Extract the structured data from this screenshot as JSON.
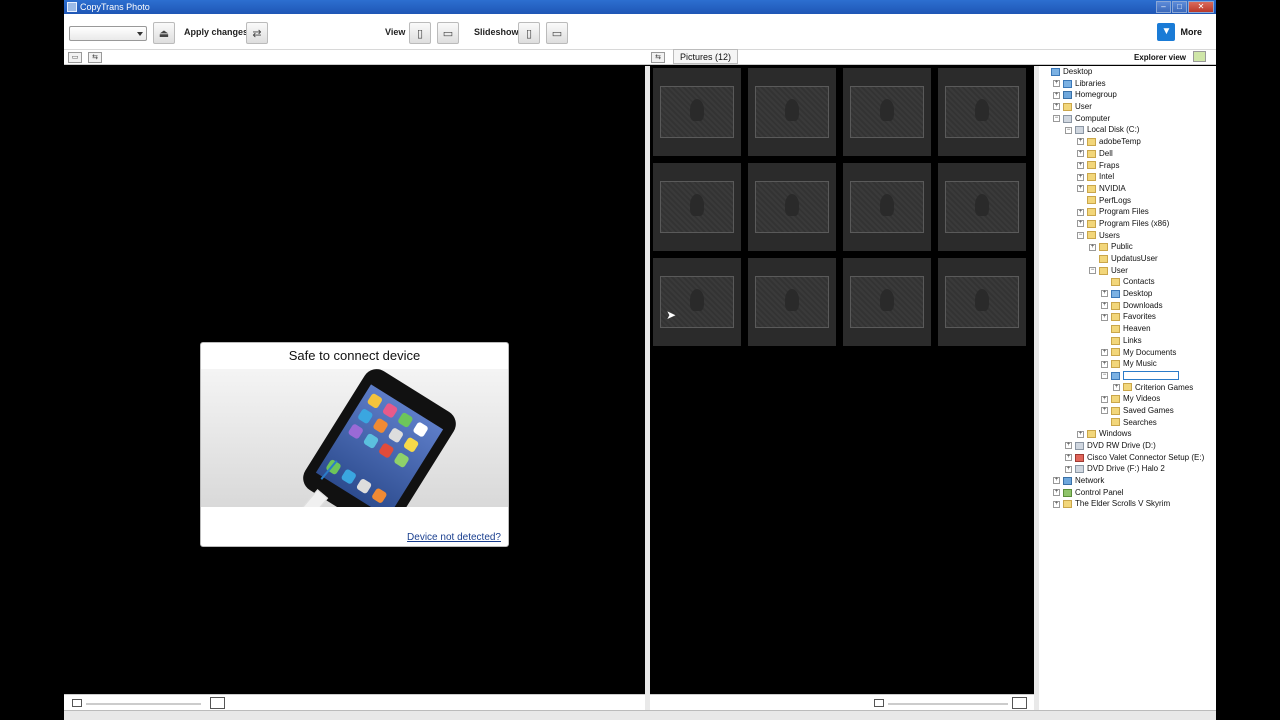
{
  "window": {
    "title": "CopyTrans Photo"
  },
  "toolbar": {
    "apply_label": "Apply changes",
    "view_label": "View",
    "slideshow_label": "Slideshow",
    "more_label": "More"
  },
  "pictures_tab": {
    "label": "Pictures (12)"
  },
  "explorer": {
    "label": "Explorer view"
  },
  "dialog": {
    "title": "Safe to connect device",
    "link": "Device not detected?"
  },
  "thumbnails": {
    "count": 12
  },
  "tree": {
    "items": [
      {
        "label": "Desktop",
        "depth": 0,
        "expander": "",
        "icon": "blue"
      },
      {
        "label": "Libraries",
        "depth": 1,
        "expander": "+",
        "icon": "blue"
      },
      {
        "label": "Homegroup",
        "depth": 1,
        "expander": "+",
        "icon": "net"
      },
      {
        "label": "User",
        "depth": 1,
        "expander": "+",
        "icon": "folder"
      },
      {
        "label": "Computer",
        "depth": 1,
        "expander": "−",
        "icon": "drive"
      },
      {
        "label": "Local Disk (C:)",
        "depth": 2,
        "expander": "−",
        "icon": "drive"
      },
      {
        "label": "adobeTemp",
        "depth": 3,
        "expander": "+",
        "icon": "folder"
      },
      {
        "label": "Dell",
        "depth": 3,
        "expander": "+",
        "icon": "folder"
      },
      {
        "label": "Fraps",
        "depth": 3,
        "expander": "+",
        "icon": "folder"
      },
      {
        "label": "Intel",
        "depth": 3,
        "expander": "+",
        "icon": "folder"
      },
      {
        "label": "NVIDIA",
        "depth": 3,
        "expander": "+",
        "icon": "folder"
      },
      {
        "label": "PerfLogs",
        "depth": 3,
        "expander": "",
        "icon": "folder"
      },
      {
        "label": "Program Files",
        "depth": 3,
        "expander": "+",
        "icon": "folder"
      },
      {
        "label": "Program Files (x86)",
        "depth": 3,
        "expander": "+",
        "icon": "folder"
      },
      {
        "label": "Users",
        "depth": 3,
        "expander": "−",
        "icon": "folder"
      },
      {
        "label": "Public",
        "depth": 4,
        "expander": "+",
        "icon": "folder"
      },
      {
        "label": "UpdatusUser",
        "depth": 4,
        "expander": "",
        "icon": "folder"
      },
      {
        "label": "User",
        "depth": 4,
        "expander": "−",
        "icon": "folder"
      },
      {
        "label": "Contacts",
        "depth": 5,
        "expander": "",
        "icon": "folder"
      },
      {
        "label": "Desktop",
        "depth": 5,
        "expander": "+",
        "icon": "blue"
      },
      {
        "label": "Downloads",
        "depth": 5,
        "expander": "+",
        "icon": "folder"
      },
      {
        "label": "Favorites",
        "depth": 5,
        "expander": "+",
        "icon": "folder"
      },
      {
        "label": "Heaven",
        "depth": 5,
        "expander": "",
        "icon": "folder"
      },
      {
        "label": "Links",
        "depth": 5,
        "expander": "",
        "icon": "folder"
      },
      {
        "label": "My Documents",
        "depth": 5,
        "expander": "+",
        "icon": "folder"
      },
      {
        "label": "My Music",
        "depth": 5,
        "expander": "+",
        "icon": "folder"
      },
      {
        "label": "",
        "depth": 5,
        "expander": "−",
        "icon": "blue",
        "editing": true
      },
      {
        "label": "Criterion Games",
        "depth": 6,
        "expander": "+",
        "icon": "folder"
      },
      {
        "label": "My Videos",
        "depth": 5,
        "expander": "+",
        "icon": "folder"
      },
      {
        "label": "Saved Games",
        "depth": 5,
        "expander": "+",
        "icon": "folder"
      },
      {
        "label": "Searches",
        "depth": 5,
        "expander": "",
        "icon": "folder"
      },
      {
        "label": "Windows",
        "depth": 3,
        "expander": "+",
        "icon": "folder"
      },
      {
        "label": "DVD RW Drive (D:)",
        "depth": 2,
        "expander": "+",
        "icon": "drive"
      },
      {
        "label": "Cisco Valet Connector Setup (E:)",
        "depth": 2,
        "expander": "+",
        "icon": "red"
      },
      {
        "label": "DVD Drive (F:) Halo 2",
        "depth": 2,
        "expander": "+",
        "icon": "drive"
      },
      {
        "label": "Network",
        "depth": 1,
        "expander": "+",
        "icon": "net"
      },
      {
        "label": "Control Panel",
        "depth": 1,
        "expander": "+",
        "icon": "cp"
      },
      {
        "label": "The Elder Scrolls V Skyrim",
        "depth": 1,
        "expander": "+",
        "icon": "folder"
      }
    ]
  }
}
